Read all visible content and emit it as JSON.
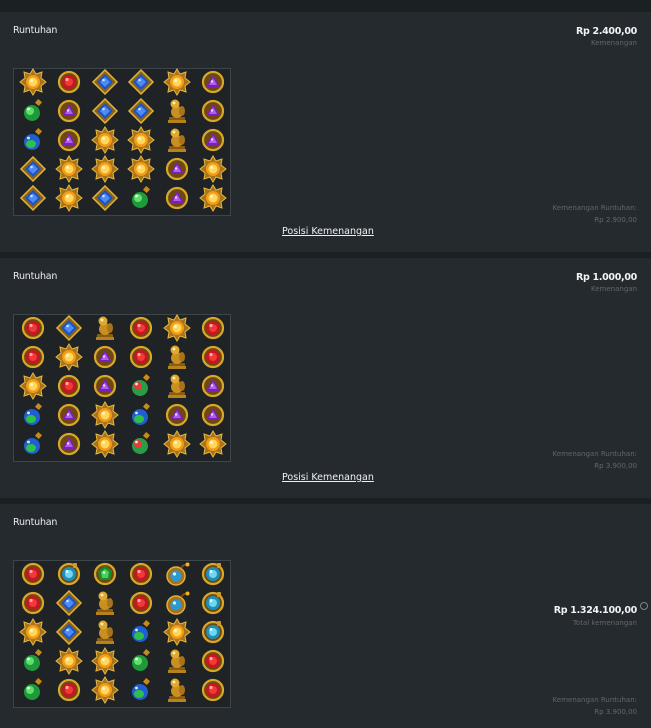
{
  "rounds": [
    {
      "title": "Runtuhan",
      "win_amount": "Rp 2.400,00",
      "win_label": "Kemenangan",
      "cascade_label": "Kemenangan Runtuhan:",
      "cascade_amount": "Rp 2.900,00",
      "link_label": "Posisi Kemenangan",
      "grid": [
        [
          "sun-gem",
          "red-gem",
          "blue-gem",
          "blue-gem",
          "sun-gem",
          "purple-gem"
        ],
        [
          "potion-green",
          "purple-gem",
          "blue-gem",
          "blue-gem",
          "gold-idol",
          "purple-gem"
        ],
        [
          "potion-blue",
          "purple-gem",
          "sun-gem",
          "sun-gem",
          "gold-idol",
          "purple-gem"
        ],
        [
          "blue-gem",
          "sun-gem",
          "sun-gem",
          "sun-gem",
          "purple-gem",
          "sun-gem"
        ],
        [
          "blue-gem",
          "sun-gem",
          "blue-gem",
          "potion-green",
          "purple-gem",
          "sun-gem"
        ]
      ]
    },
    {
      "title": "Runtuhan",
      "win_amount": "Rp 1.000,00",
      "win_label": "Kemenangan",
      "cascade_label": "Kemenangan Runtuhan:",
      "cascade_amount": "Rp 3.900,00",
      "link_label": "Posisi Kemenangan",
      "grid": [
        [
          "red-gem",
          "blue-gem",
          "gold-idol",
          "red-gem",
          "sun-gem",
          "red-gem"
        ],
        [
          "red-gem",
          "sun-gem",
          "purple-gem",
          "red-gem",
          "gold-idol",
          "red-gem"
        ],
        [
          "sun-gem",
          "red-gem",
          "purple-gem",
          "potion-red",
          "gold-idol",
          "purple-gem"
        ],
        [
          "potion-blue",
          "purple-gem",
          "sun-gem",
          "potion-blue",
          "purple-gem",
          "purple-gem"
        ],
        [
          "potion-blue",
          "purple-gem",
          "sun-gem",
          "potion-red",
          "sun-gem",
          "sun-gem"
        ]
      ]
    },
    {
      "title": "Runtuhan",
      "win_amount": "Rp 1.324.100,00",
      "win_label": "Total kemenangan",
      "cascade_label": "Kemenangan Runtuhan:",
      "cascade_amount": "Rp 3.900,00",
      "grid": [
        [
          "red-gem",
          "cyan-amulet",
          "green-gem",
          "red-gem",
          "bomb",
          "cyan-amulet"
        ],
        [
          "red-gem",
          "blue-gem",
          "gold-idol",
          "red-gem",
          "bomb",
          "cyan-amulet"
        ],
        [
          "sun-gem",
          "blue-gem",
          "gold-idol",
          "potion-blue",
          "sun-gem",
          "cyan-amulet"
        ],
        [
          "potion-green",
          "sun-gem",
          "sun-gem",
          "potion-green",
          "gold-idol",
          "red-gem"
        ],
        [
          "potion-green",
          "red-gem",
          "sun-gem",
          "potion-blue",
          "gold-idol",
          "red-gem"
        ]
      ]
    }
  ],
  "colors": {
    "card_bg": "#252a2e",
    "page_bg": "#1b2023",
    "grid_bg": "#1f2326",
    "muted_text": "#5f676e"
  }
}
